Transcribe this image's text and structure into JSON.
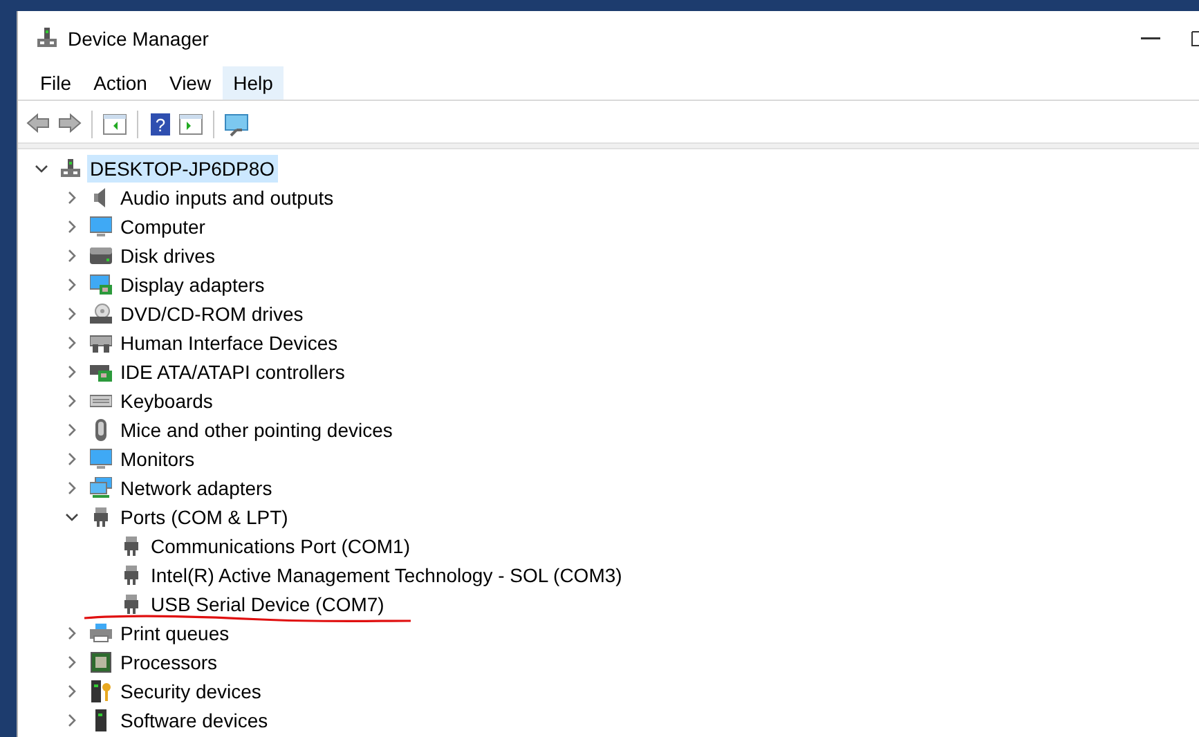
{
  "window": {
    "title": "Device Manager"
  },
  "menu": [
    {
      "label": "File",
      "selected": false
    },
    {
      "label": "Action",
      "selected": false
    },
    {
      "label": "View",
      "selected": false
    },
    {
      "label": "Help",
      "selected": true
    }
  ],
  "toolbar": [
    {
      "kind": "back",
      "disabled": true
    },
    {
      "kind": "forward",
      "disabled": true
    },
    {
      "kind": "sep"
    },
    {
      "kind": "pane",
      "disabled": false
    },
    {
      "kind": "sep"
    },
    {
      "kind": "help",
      "disabled": false,
      "glyph": "?"
    },
    {
      "kind": "properties",
      "disabled": false
    },
    {
      "kind": "sep"
    },
    {
      "kind": "scan",
      "disabled": false
    }
  ],
  "tree": [
    {
      "label": "DESKTOP-JP6DP8O",
      "kind": "pc",
      "selected": true,
      "expanded": true,
      "children": [
        {
          "label": "Audio inputs and outputs",
          "kind": "audio",
          "selected": false,
          "expanded": false
        },
        {
          "label": "Computer",
          "kind": "monitor",
          "selected": false,
          "expanded": false
        },
        {
          "label": "Disk drives",
          "kind": "disk",
          "selected": false,
          "expanded": false
        },
        {
          "label": "Display adapters",
          "kind": "display",
          "selected": false,
          "expanded": false
        },
        {
          "label": "DVD/CD-ROM drives",
          "kind": "dvd",
          "selected": false,
          "expanded": false
        },
        {
          "label": "Human Interface Devices",
          "kind": "hid",
          "selected": false,
          "expanded": false
        },
        {
          "label": "IDE ATA/ATAPI controllers",
          "kind": "ide",
          "selected": false,
          "expanded": false
        },
        {
          "label": "Keyboards",
          "kind": "keyboard",
          "selected": false,
          "expanded": false
        },
        {
          "label": "Mice and other pointing devices",
          "kind": "mouse",
          "selected": false,
          "expanded": false
        },
        {
          "label": "Monitors",
          "kind": "monitor",
          "selected": false,
          "expanded": false
        },
        {
          "label": "Network adapters",
          "kind": "network",
          "selected": false,
          "expanded": false
        },
        {
          "label": "Ports (COM & LPT)",
          "kind": "port",
          "selected": false,
          "expanded": true,
          "children": [
            {
              "label": "Communications Port (COM1)",
              "kind": "port",
              "selected": false
            },
            {
              "label": "Intel(R) Active Management Technology - SOL (COM3)",
              "kind": "port",
              "selected": false
            },
            {
              "label": "USB Serial Device (COM7)",
              "kind": "port",
              "selected": false,
              "underlined": true
            }
          ]
        },
        {
          "label": "Print queues",
          "kind": "printer",
          "selected": false,
          "expanded": false
        },
        {
          "label": "Processors",
          "kind": "cpu",
          "selected": false,
          "expanded": false
        },
        {
          "label": "Security devices",
          "kind": "security",
          "selected": false,
          "expanded": false
        },
        {
          "label": "Software devices",
          "kind": "software",
          "selected": false,
          "expanded": false
        }
      ]
    }
  ]
}
